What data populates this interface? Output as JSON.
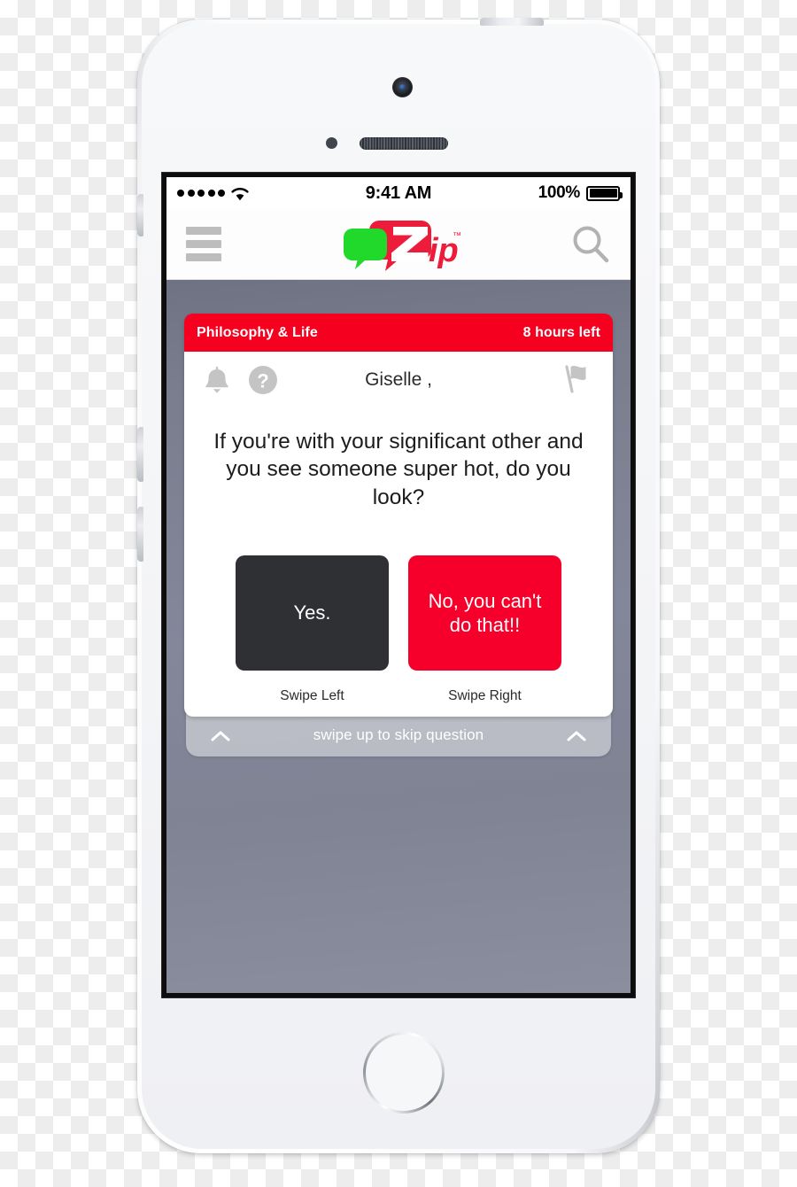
{
  "device": {
    "name": "white-smartphone-mockup"
  },
  "status_bar": {
    "signal_dots": 5,
    "wifi_icon": "wifi-icon",
    "time": "9:41 AM",
    "battery_percent": "100%",
    "battery_icon": "battery-full-icon"
  },
  "nav_bar": {
    "menu_icon": "hamburger-menu-icon",
    "app_name": "Zip",
    "logo_trademark": "™",
    "search_icon": "search-icon",
    "brand_red": "#ec1c3a",
    "brand_green": "#21d92a"
  },
  "card": {
    "category": "Philosophy & Life",
    "time_left": "8 hours left",
    "header_color": "#f6001f",
    "toolbar": {
      "notify_icon": "bell-icon",
      "help_icon": "question-mark-circle-icon",
      "report_icon": "flag-icon"
    },
    "recipient": "Giselle ,",
    "question": "If you're with your significant other and you see someone super hot, do you look?",
    "prev_arrow_icon": "chevron-left-icon",
    "next_arrow_icon": "chevron-right-icon",
    "answers": [
      {
        "label": "Yes.",
        "hint": "Swipe Left",
        "color": "#2e3033"
      },
      {
        "label": "No, you can't do that!!",
        "hint": "Swipe Right",
        "color": "#f6002b"
      }
    ]
  },
  "skip_bar": {
    "text": "swipe up to skip question",
    "left_icon": "chevron-up-icon",
    "right_icon": "chevron-up-icon"
  },
  "background": {
    "app_gradient_top": "#6e7282",
    "app_gradient_bottom": "#8a8e9e"
  }
}
